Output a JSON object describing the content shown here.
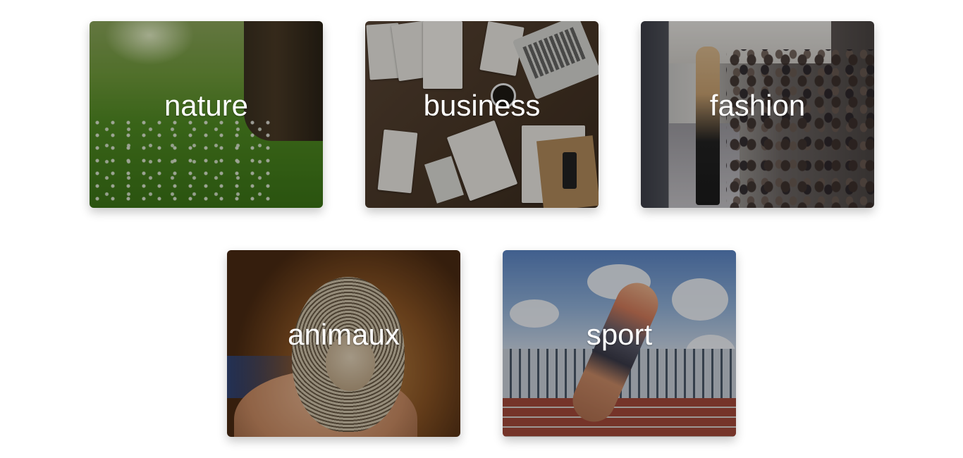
{
  "categories": [
    {
      "id": "nature",
      "label": "nature"
    },
    {
      "id": "business",
      "label": "business"
    },
    {
      "id": "fashion",
      "label": "fashion"
    },
    {
      "id": "animaux",
      "label": "animaux"
    },
    {
      "id": "sport",
      "label": "sport"
    }
  ],
  "colors": {
    "background": "#ffffff",
    "label_text": "#ffffff"
  }
}
